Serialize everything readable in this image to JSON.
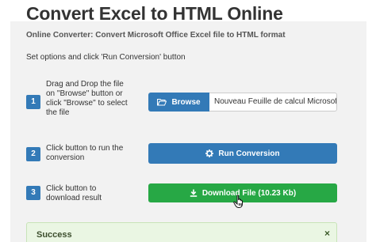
{
  "page": {
    "title": "Convert Excel to HTML Online",
    "subtitle": "Online Converter: Convert Microsoft Office Excel file to HTML format",
    "instructions": "Set options and click 'Run Conversion' button"
  },
  "steps": [
    {
      "number": "1",
      "text_lines": [
        "Drag and Drop the file",
        "on \"Browse\" button or",
        "click \"Browse\" to select",
        "the file"
      ]
    },
    {
      "number": "2",
      "text_lines": [
        "Click button to run the",
        "conversion"
      ]
    },
    {
      "number": "3",
      "text_lines": [
        "Click button to",
        "download result"
      ]
    }
  ],
  "browse": {
    "label": "Browse",
    "icon": "folder-open-icon",
    "file_name": "Nouveau Feuille de calcul Microsoft Excel.xlsx"
  },
  "run_button": {
    "label": "Run Conversion",
    "icon": "gear-icon"
  },
  "download_button": {
    "label": "Download File (10.23 Kb)",
    "icon": "download-icon"
  },
  "alert": {
    "title": "Success",
    "close": "×"
  },
  "colors": {
    "primary": "#337ab7",
    "success": "#27a845",
    "panel": "#f2f2f2",
    "alert_bg": "#eaf6e3"
  }
}
